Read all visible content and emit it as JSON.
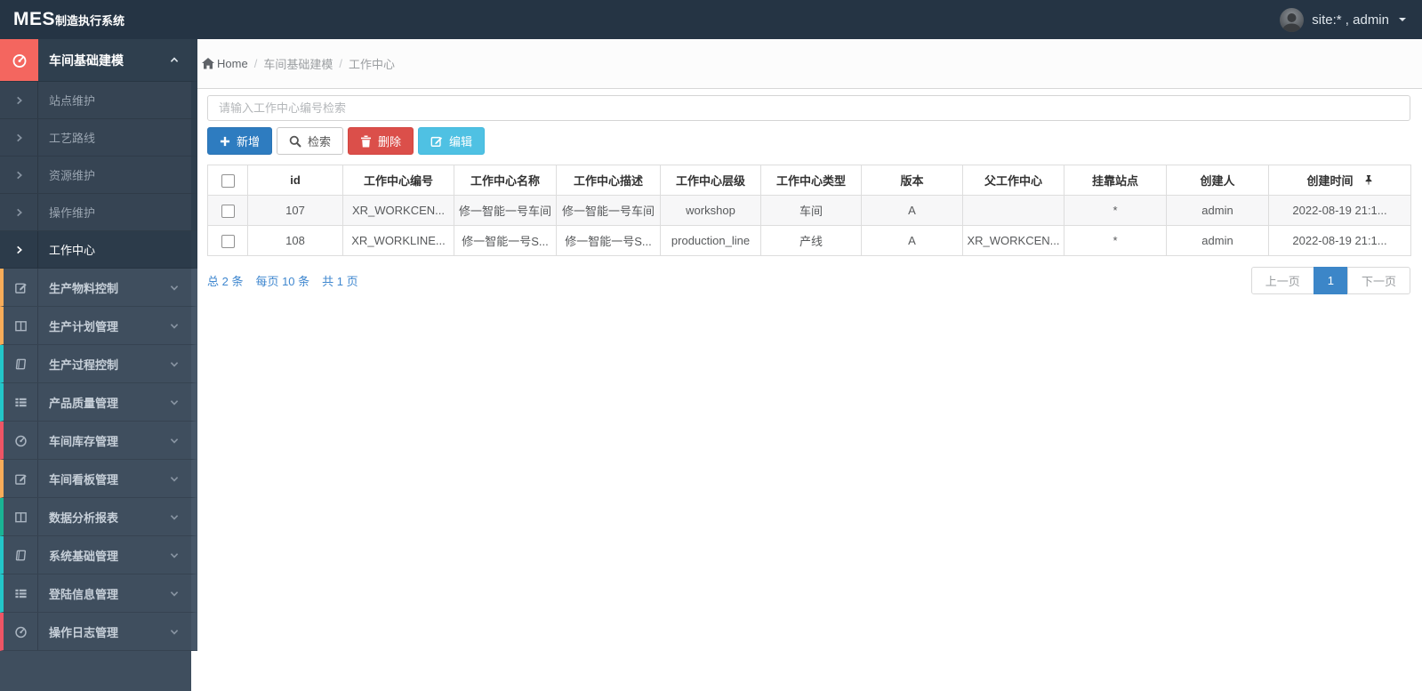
{
  "navbar": {
    "brand_bold": "MES",
    "brand_rest": "制造执行系统",
    "user_label": "site:* , admin",
    "avatar_icon": "user-avatar",
    "caret_icon": "caret-down-icon"
  },
  "breadcrumb": {
    "home": "Home",
    "home_icon": "home-icon",
    "separator": "/",
    "crumbs": [
      "车间基础建模",
      "工作中心"
    ]
  },
  "sidebar": {
    "active_group": {
      "label": "车间基础建模",
      "icon": "dashboard-icon",
      "accent": "#f4665f"
    },
    "submenu": [
      {
        "label": "站点维护",
        "active": false
      },
      {
        "label": "工艺路线",
        "active": false
      },
      {
        "label": "资源维护",
        "active": false
      },
      {
        "label": "操作维护",
        "active": false
      },
      {
        "label": "工作中心",
        "active": true
      }
    ],
    "groups": [
      {
        "label": "生产物料控制",
        "icon": "edit-icon",
        "accent": "#f8ac59"
      },
      {
        "label": "生产计划管理",
        "icon": "columns-icon",
        "accent": "#f8ac59"
      },
      {
        "label": "生产过程控制",
        "icon": "book-icon",
        "accent": "#23c6c8"
      },
      {
        "label": "产品质量管理",
        "icon": "list-icon",
        "accent": "#23c6c8"
      },
      {
        "label": "车间库存管理",
        "icon": "dashboard-icon",
        "accent": "#ed5565"
      },
      {
        "label": "车间看板管理",
        "icon": "edit-icon",
        "accent": "#f8ac59"
      },
      {
        "label": "数据分析报表",
        "icon": "columns-icon",
        "accent": "#1ab394"
      },
      {
        "label": "系统基础管理",
        "icon": "book-icon",
        "accent": "#23c6c8"
      },
      {
        "label": "登陆信息管理",
        "icon": "list-icon",
        "accent": "#23c6c8"
      },
      {
        "label": "操作日志管理",
        "icon": "dashboard-icon",
        "accent": "#ed5565"
      }
    ]
  },
  "toolbar": {
    "search_placeholder": "请输入工作中心编号检索",
    "add_label": "新增",
    "search_label": "检索",
    "delete_label": "删除",
    "edit_label": "编辑",
    "icons": {
      "add": "plus-icon",
      "search": "search-icon",
      "delete": "trash-icon",
      "edit": "edit-square-icon"
    }
  },
  "table": {
    "columns": [
      "id",
      "工作中心编号",
      "工作中心名称",
      "工作中心描述",
      "工作中心层级",
      "工作中心类型",
      "版本",
      "父工作中心",
      "挂靠站点",
      "创建人",
      "创建时间"
    ],
    "pin_icon": "pin-icon",
    "rows": [
      {
        "id": "107",
        "code": "XR_WORKCEN...",
        "name": "修一智能一号车间",
        "desc": "修一智能一号车间",
        "level": "workshop",
        "type": "车间",
        "version": "A",
        "parent": "",
        "station": "*",
        "creator": "admin",
        "created": "2022-08-19 21:1..."
      },
      {
        "id": "108",
        "code": "XR_WORKLINE...",
        "name": "修一智能一号S...",
        "desc": "修一智能一号S...",
        "level": "production_line",
        "type": "产线",
        "version": "A",
        "parent": "XR_WORKCEN...",
        "station": "*",
        "creator": "admin",
        "created": "2022-08-19 21:1..."
      }
    ]
  },
  "pagination": {
    "total": "总 2 条",
    "per_page": "每页 10 条",
    "pages": "共 1 页",
    "prev": "上一页",
    "current": "1",
    "next": "下一页"
  },
  "colors": {
    "navbar_bg": "#253444",
    "sidebar_bg": "#3f4e5e",
    "active_icon_block": "#f4665f",
    "primary_blue": "#2e7cc0",
    "danger_red": "#db4f4a",
    "info_blue": "#4fc1e3",
    "link_blue": "#3f87cf",
    "page_active_blue": "#3c86c8",
    "accent_yellow": "#f8ac59",
    "accent_green": "#1ab394",
    "accent_teal": "#23c6c8",
    "accent_red": "#ed5565"
  }
}
